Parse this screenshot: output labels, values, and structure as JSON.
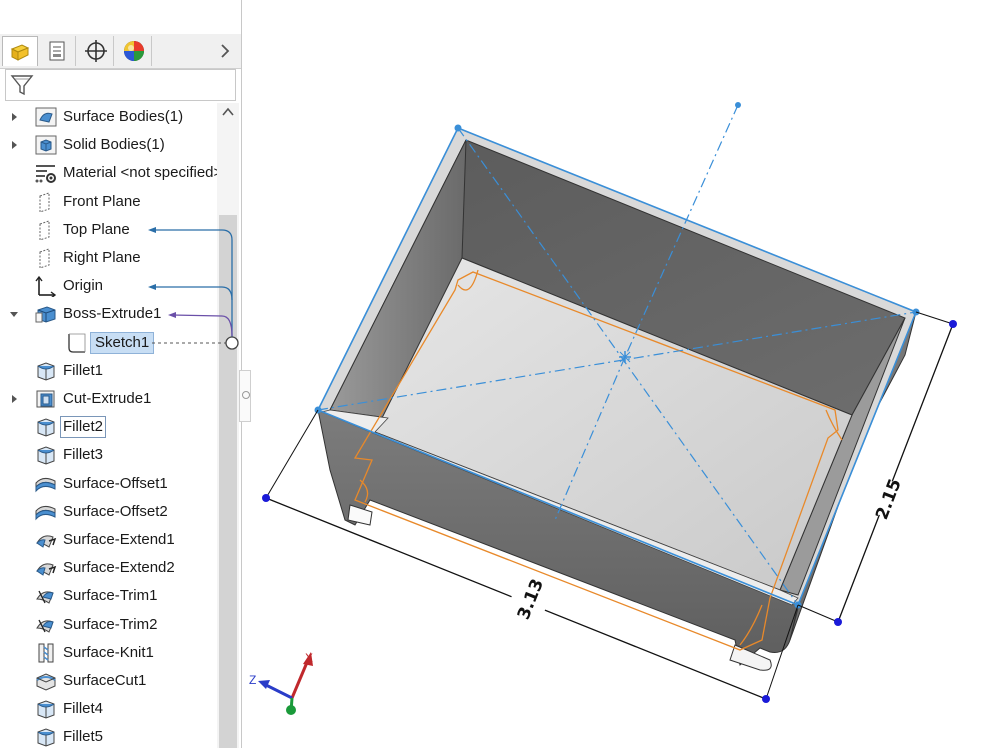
{
  "feature_manager": {
    "tabs": [
      {
        "icon": "feature-manager-icon"
      },
      {
        "icon": "property-manager-icon"
      },
      {
        "icon": "configuration-manager-icon"
      },
      {
        "icon": "display-manager-icon"
      }
    ],
    "more_icon": "chevron-right-icon",
    "filter_icon": "filter-icon",
    "tree": [
      {
        "label": "Surface Bodies(1)",
        "icon": "surface-bodies-folder-icon",
        "expander": "collapsed"
      },
      {
        "label": "Solid Bodies(1)",
        "icon": "solid-bodies-folder-icon",
        "expander": "collapsed"
      },
      {
        "label": "Material <not specified>",
        "icon": "material-icon",
        "expander": "none"
      },
      {
        "label": "Front Plane",
        "icon": "plane-icon",
        "expander": "none"
      },
      {
        "label": "Top Plane",
        "icon": "plane-icon",
        "expander": "none"
      },
      {
        "label": "Right Plane",
        "icon": "plane-icon",
        "expander": "none"
      },
      {
        "label": "Origin",
        "icon": "origin-icon",
        "expander": "none"
      },
      {
        "label": "Boss-Extrude1",
        "icon": "extrude-icon",
        "expander": "expanded"
      },
      {
        "label": "Sketch1",
        "icon": "sketch-icon",
        "expander": "none"
      },
      {
        "label": "Fillet1",
        "icon": "fillet-icon",
        "expander": "none"
      },
      {
        "label": "Cut-Extrude1",
        "icon": "cut-extrude-icon",
        "expander": "collapsed"
      },
      {
        "label": "Fillet2",
        "icon": "fillet-icon",
        "expander": "none"
      },
      {
        "label": "Fillet3",
        "icon": "fillet-icon",
        "expander": "none"
      },
      {
        "label": "Surface-Offset1",
        "icon": "surface-offset-icon",
        "expander": "none"
      },
      {
        "label": "Surface-Offset2",
        "icon": "surface-offset-icon",
        "expander": "none"
      },
      {
        "label": "Surface-Extend1",
        "icon": "surface-extend-icon",
        "expander": "none"
      },
      {
        "label": "Surface-Extend2",
        "icon": "surface-extend-icon",
        "expander": "none"
      },
      {
        "label": "Surface-Trim1",
        "icon": "surface-trim-icon",
        "expander": "none"
      },
      {
        "label": "Surface-Trim2",
        "icon": "surface-trim-icon",
        "expander": "none"
      },
      {
        "label": "Surface-Knit1",
        "icon": "surface-knit-icon",
        "expander": "none"
      },
      {
        "label": "SurfaceCut1",
        "icon": "surface-cut-icon",
        "expander": "none"
      },
      {
        "label": "Fillet4",
        "icon": "fillet-icon",
        "expander": "none"
      },
      {
        "label": "Fillet5",
        "icon": "fillet-icon",
        "expander": "none"
      }
    ],
    "selected_item": "Sketch1",
    "highlighted_item": "Fillet2"
  },
  "viewport": {
    "dimensions": [
      {
        "name": "length",
        "value": "3.13"
      },
      {
        "name": "width",
        "value": "2.15"
      }
    ],
    "triad": {
      "x_label": "X",
      "z_label": "Z"
    }
  },
  "colors": {
    "sketch_blue": "#3a8fd8",
    "profile_orange": "#e8892a",
    "dimension_black": "#111111",
    "selection_blue": "#c8def4",
    "triad_x": "#c0282c",
    "triad_y": "#1a9a3a",
    "triad_z": "#2a3cc8"
  }
}
